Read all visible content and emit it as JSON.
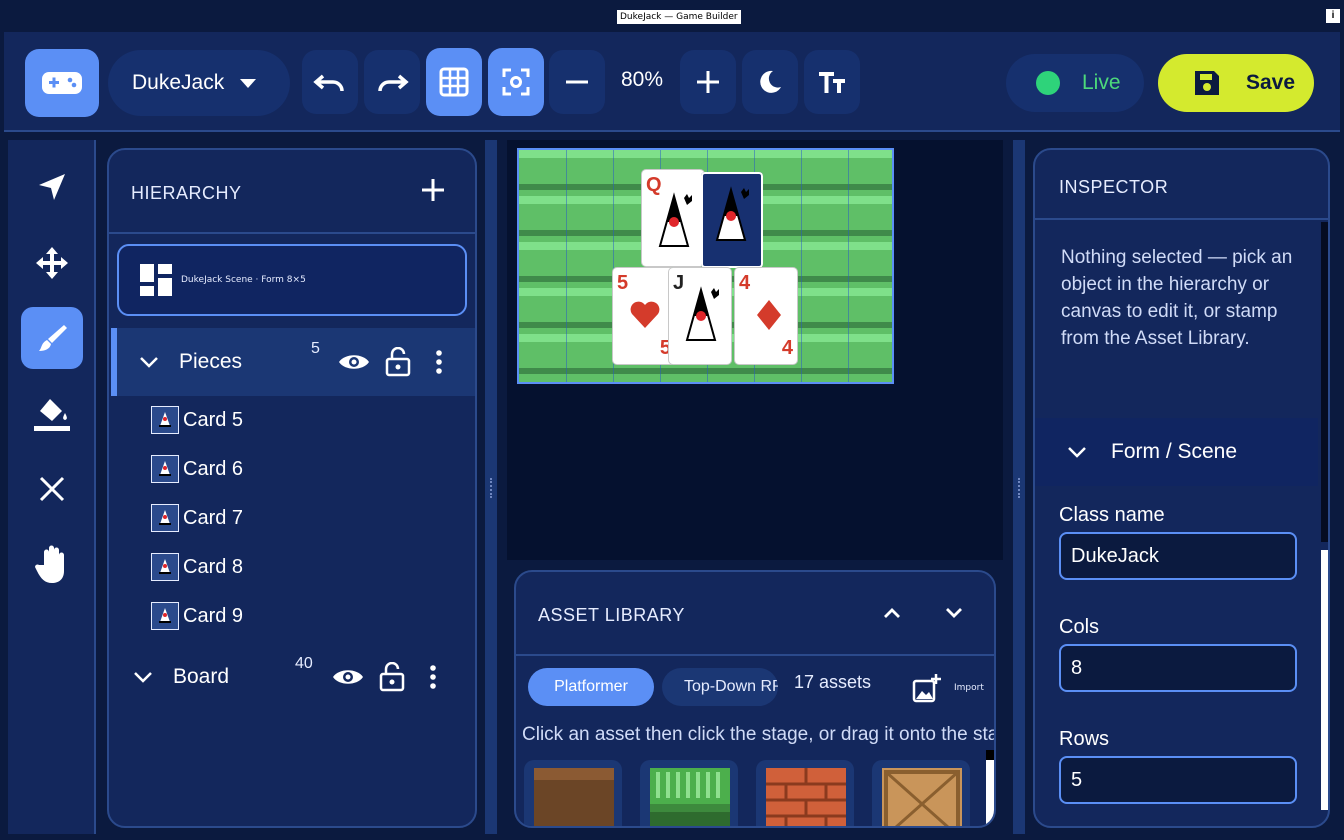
{
  "window": {
    "title": "DukeJack — Game Builder",
    "info_glyph": "i"
  },
  "toolbar": {
    "app_icon": "gamepad-icon",
    "project_name": "DukeJack",
    "zoom": "80%",
    "live_label": "Live",
    "save_label": "Save",
    "icons": [
      "undo-icon",
      "redo-icon",
      "grid-icon",
      "focus-icon",
      "zoom-out-icon",
      "zoom-in-icon",
      "dark-mode-icon",
      "text-size-icon"
    ]
  },
  "rail": {
    "tools": [
      "select-arrow-icon",
      "move-icon",
      "brush-icon",
      "fill-bucket-icon",
      "erase-icon",
      "hand-icon"
    ],
    "active": "brush-icon"
  },
  "hierarchy": {
    "title": "HIERARCHY",
    "scene_label": "DukeJack Scene · Form 8×5",
    "groups": [
      {
        "name": "Pieces",
        "count": "5",
        "expanded": true,
        "children": [
          "Card 5",
          "Card 6",
          "Card 7",
          "Card 8",
          "Card 9"
        ]
      },
      {
        "name": "Board",
        "count": "40",
        "expanded": true,
        "children": []
      }
    ]
  },
  "canvas": {
    "cards": [
      {
        "rank": "Q",
        "corner": ""
      },
      {
        "rank": "",
        "corner": ""
      },
      {
        "rank": "5",
        "corner": "5"
      },
      {
        "rank": "J",
        "corner": ""
      },
      {
        "rank": "4",
        "corner": "4"
      }
    ]
  },
  "asset_library": {
    "title": "ASSET LIBRARY",
    "tabs": [
      "Platformer",
      "Top-Down RPG"
    ],
    "active_tab": "Platformer",
    "count": "17 assets",
    "import_label": "Import",
    "hint": "Click an asset then click the stage, or drag it onto the stage",
    "tiles": [
      "dirt-tile",
      "grass-tile",
      "brick-tile",
      "crate-tile"
    ]
  },
  "inspector": {
    "title": "INSPECTOR",
    "message": "Nothing selected — pick an object in the hierarchy or canvas to edit it, or stamp from the Asset Library.",
    "section": "Form / Scene",
    "fields": [
      {
        "label": "Class name",
        "value": "DukeJack"
      },
      {
        "label": "Cols",
        "value": "8"
      },
      {
        "label": "Rows",
        "value": "5"
      }
    ]
  },
  "colors": {
    "accent": "#5b8ff5",
    "save": "#d4ea2e",
    "live": "#2ed37a",
    "panel": "#13275c",
    "bg": "#0b1a3f"
  }
}
